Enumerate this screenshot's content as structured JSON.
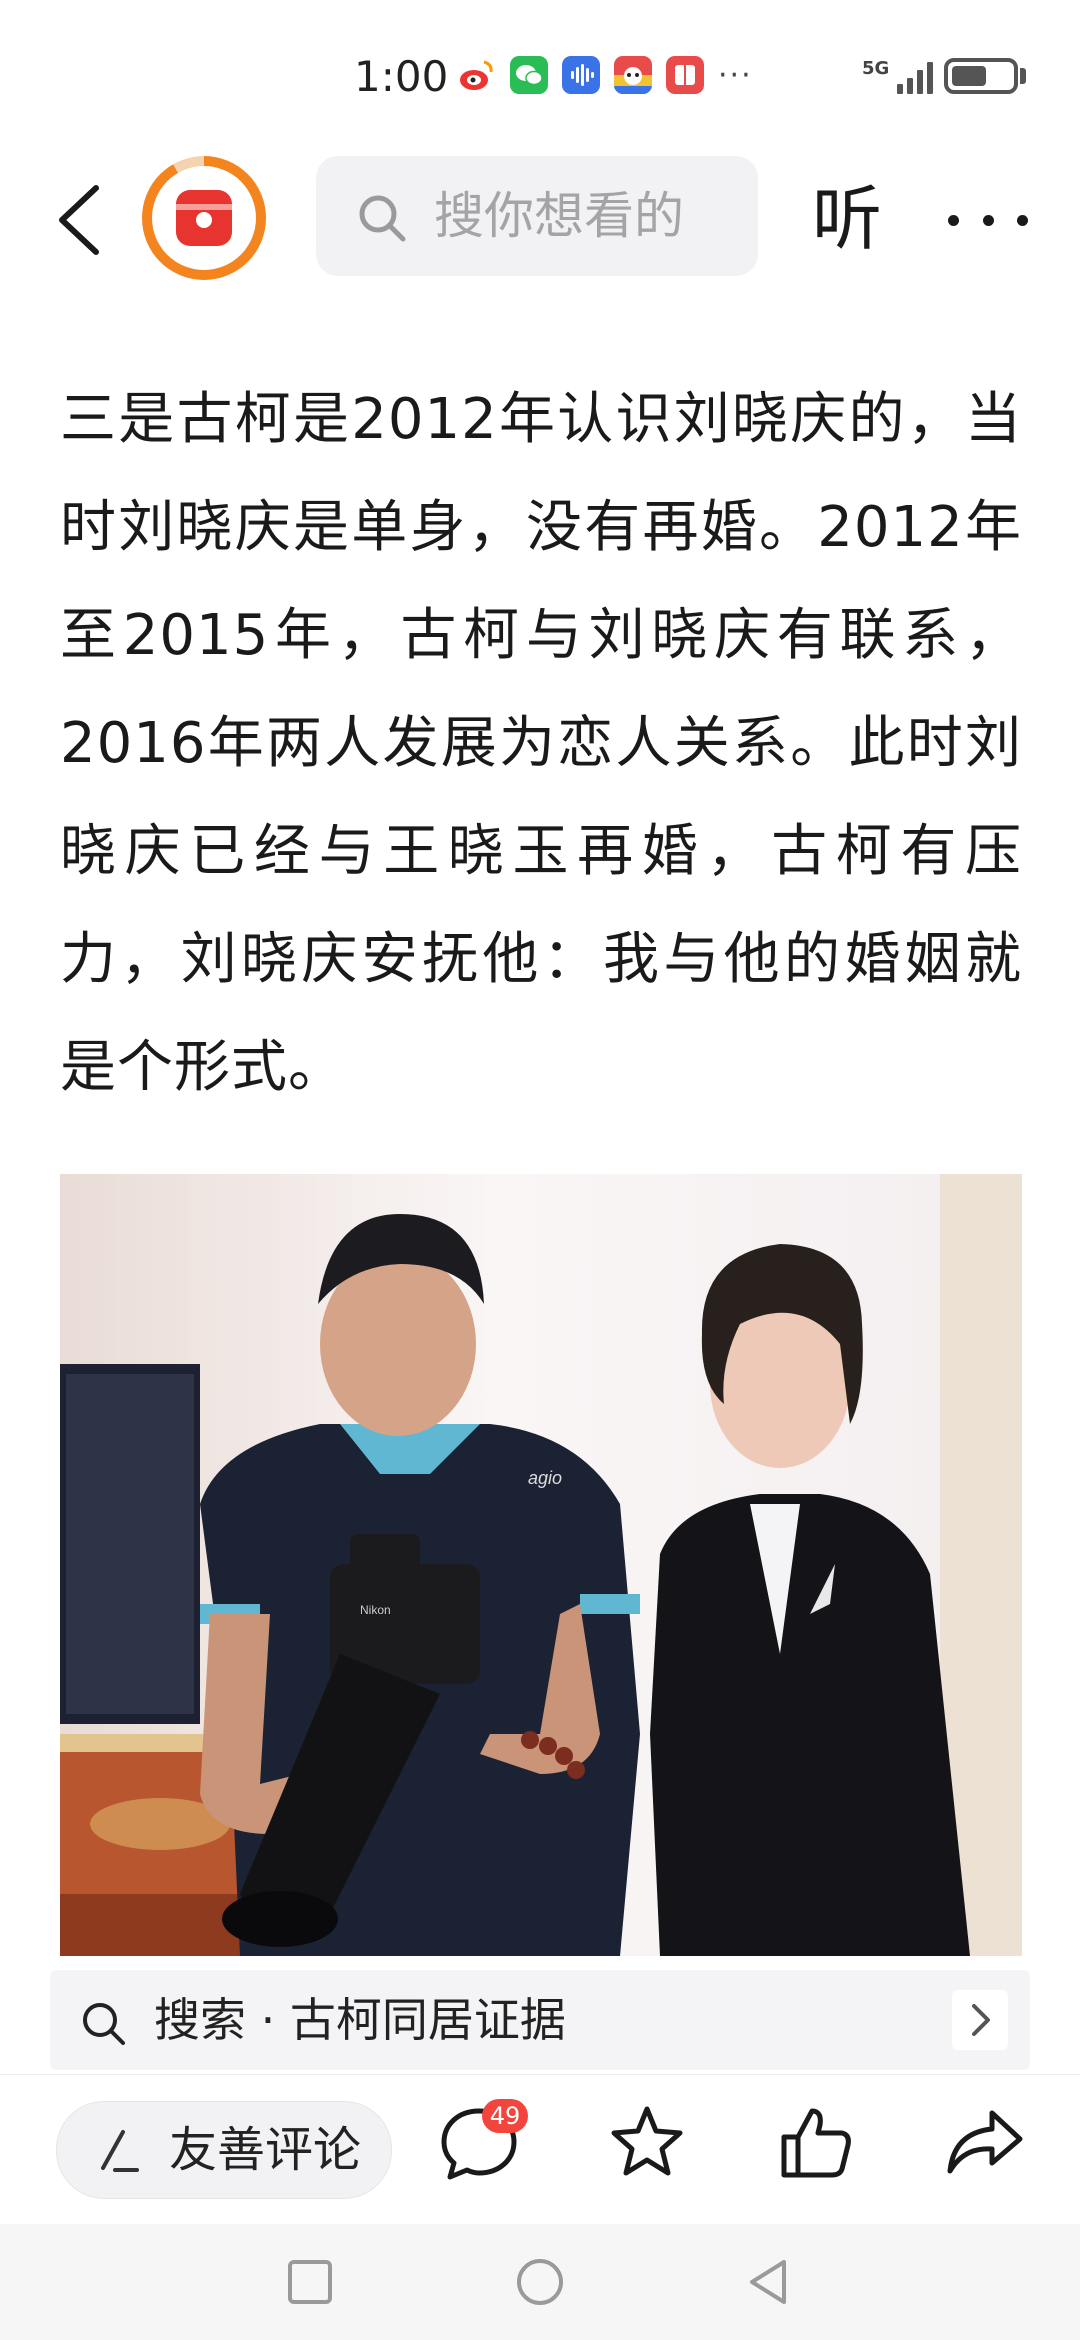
{
  "status_bar": {
    "time": "1:00",
    "apps": [
      "sina-weibo-icon",
      "wechat-icon",
      "voice-icon",
      "game-icon",
      "reader-icon"
    ],
    "more": "···",
    "network": "5G"
  },
  "header": {
    "search_placeholder": "搜你想看的",
    "listen_label": "听"
  },
  "article": {
    "paragraph": "三是古柯是2012年认识刘晓庆的，当时刘晓庆是单身，没有再婚。2012年至2015年，古柯与刘晓庆有联系，2016年两人发展为恋人关系。此时刘晓庆已经与王晓玉再婚，古柯有压力，刘晓庆安抚他：我与他的婚姻就是个形式。"
  },
  "photo": {
    "camera_logo": "Nikon",
    "shirt_logo": "agio"
  },
  "related_search": {
    "label": "搜索 · 古柯同居证据"
  },
  "bottom_bar": {
    "comment_placeholder": "友善评论",
    "comment_count": "49"
  },
  "colors": {
    "accent_orange": "#f4841e",
    "badge_red": "#f2453d",
    "logo_red": "#e8342f"
  }
}
